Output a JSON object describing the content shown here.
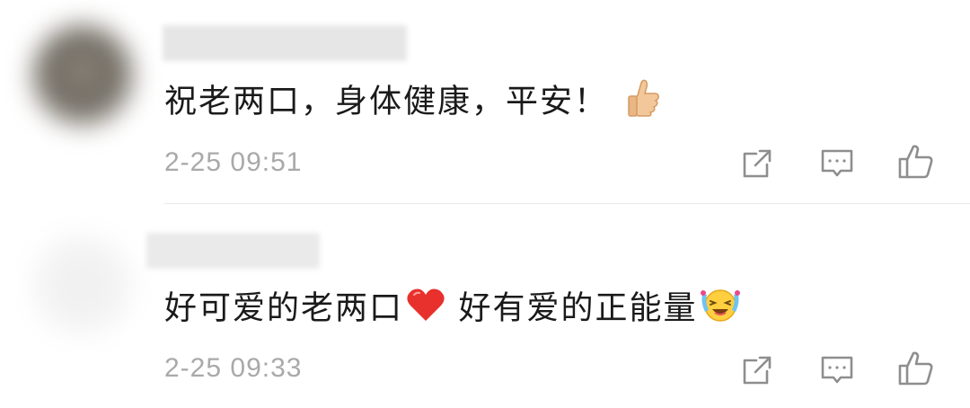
{
  "comments": [
    {
      "text": "祝老两口，身体健康，平安！",
      "emoji": "thumbs-up-emoji",
      "timestamp": "2-25 09:51"
    },
    {
      "text_part1": "好可爱的老两口",
      "emoji_mid": "red-heart-emoji",
      "text_part2": " 好有爱的正能量",
      "emoji_end": "tears-of-joy-emoji",
      "timestamp": "2-25 09:33"
    }
  ],
  "actions": {
    "share_icon": "share-icon",
    "reply_icon": "comment-reply-icon",
    "like_icon": "thumbs-up-like-icon"
  },
  "colors": {
    "text": "#1a1a1a",
    "meta": "#a9a9a9",
    "icon": "#8e8e8e",
    "divider": "#e9e9e9"
  }
}
